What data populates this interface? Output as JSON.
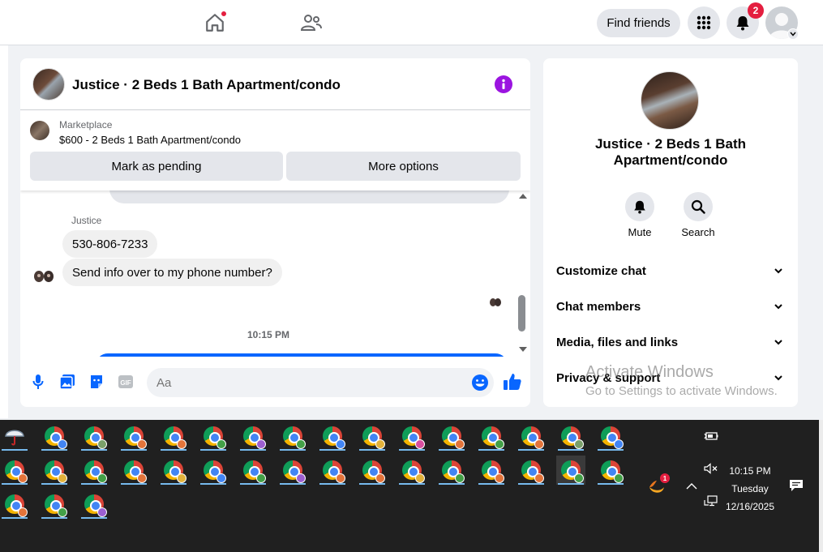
{
  "topbar": {
    "find_friends": "Find friends",
    "notifications_count": "2"
  },
  "chat": {
    "title": "Justice · 2 Beds 1 Bath Apartment/condo",
    "listing_label": "Marketplace",
    "listing_price": "$600 - 2 Beds 1 Bath Apartment/condo",
    "mark_pending": "Mark as pending",
    "more_options": "More options",
    "sender": "Justice",
    "messages": [
      "530-806-7233",
      "Send info over to my phone number?"
    ],
    "timestamp": "10:15 PM",
    "input_placeholder": "Aa"
  },
  "details": {
    "name": "Justice · 2 Beds 1 Bath Apartment/condo",
    "mute": "Mute",
    "search": "Search",
    "sections": [
      "Customize chat",
      "Chat members",
      "Media, files and links",
      "Privacy & support"
    ]
  },
  "watermark": {
    "title": "Activate Windows",
    "subtitle": "Go to Settings to activate Windows."
  },
  "taskbar": {
    "clock_time": "10:15 PM",
    "clock_day": "Tuesday",
    "clock_date": "12/16/2025",
    "app_badge": "1",
    "chrome_profile_colors": [
      "#4285f4",
      "#7aa06a",
      "#e3743a",
      "#e3743a",
      "#43a047",
      "#9c5fd1",
      "#43a047",
      "#4285f4",
      "#e3b23a",
      "#d94fa0",
      "#e3743a",
      "#43a047",
      "#e3743a",
      "#7aa06a",
      "#4285f4",
      "#e3743a",
      "#e3b23a",
      "#43a047",
      "#e3743a",
      "#e3b23a",
      "#4285f4",
      "#43a047",
      "#9c5fd1",
      "#e3743a",
      "#e3743a",
      "#e3b23a",
      "#43a047",
      "#e3743a",
      "#e3743a",
      "#43a047",
      "#43a047",
      "#e3743a",
      "#43a047",
      "#9c5fd1"
    ]
  },
  "colors": {
    "accent": "#0866ff",
    "info": "#9b14e0",
    "badge": "#e41e3f"
  }
}
